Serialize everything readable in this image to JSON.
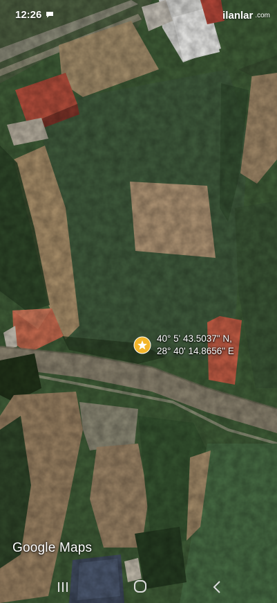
{
  "status_bar": {
    "time": "12:26",
    "notification_icon": "chat-bubble-icon"
  },
  "watermark": {
    "brand": "ilanlar",
    "domain": ".com"
  },
  "map": {
    "type": "satellite",
    "attribution": "Google Maps"
  },
  "location_marker": {
    "icon": "star-pin-icon",
    "color": "#f2b52a",
    "latitude": "40° 5' 43.5037\" N,",
    "longitude": "28° 40' 14.8656\" E"
  },
  "nav_bar": {
    "buttons": [
      "recents-icon",
      "home-icon",
      "back-icon"
    ]
  }
}
